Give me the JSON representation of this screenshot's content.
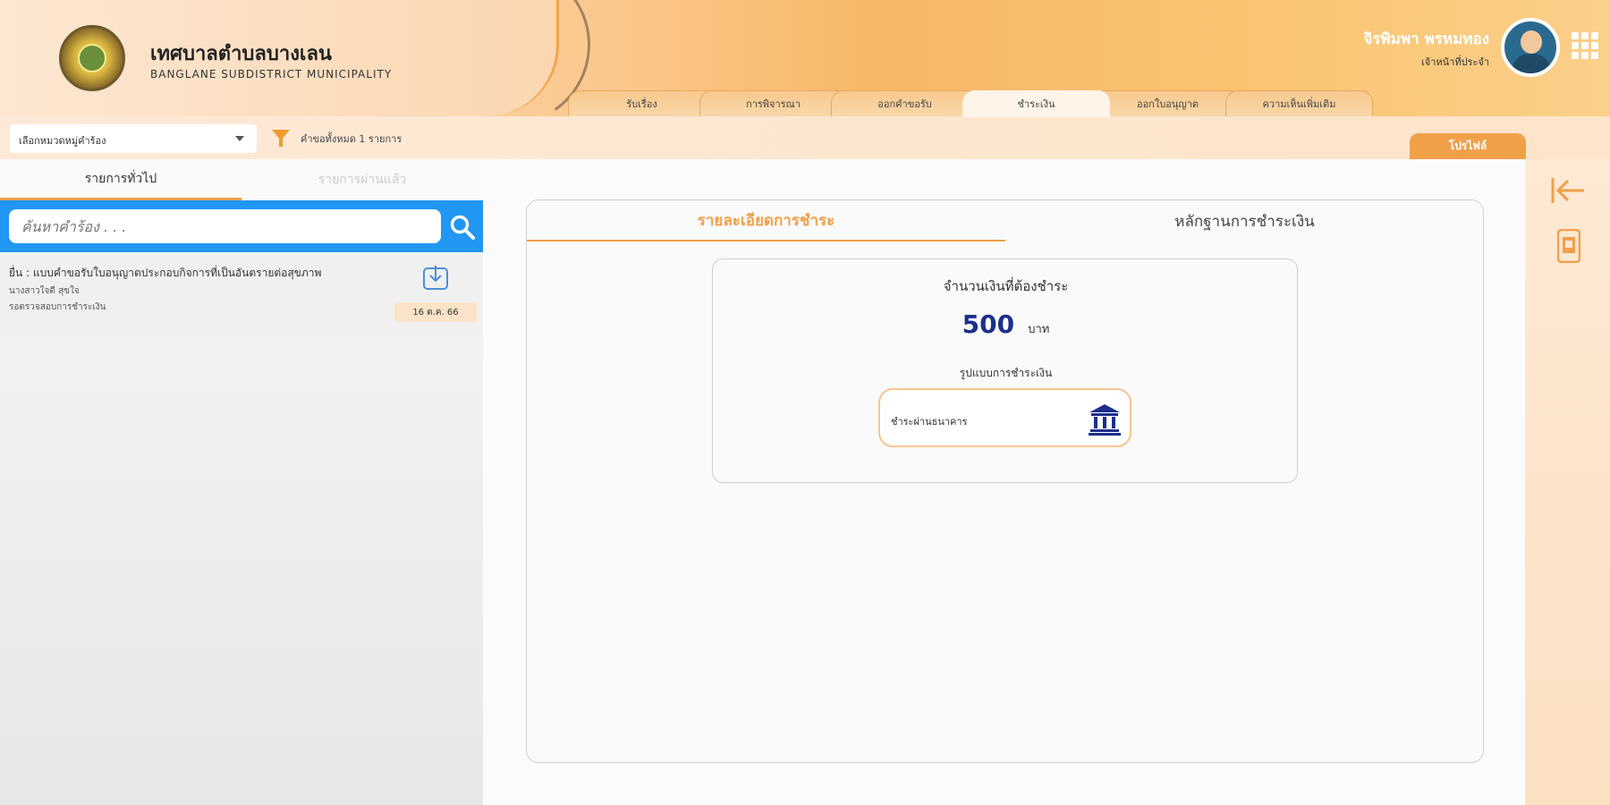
{
  "header": {
    "org_name": "เทศบาลตำบลบางเลน",
    "org_name_en": "BANGLANE SUBDISTRICT MUNICIPALITY",
    "user_name": "จิรพิมพา พรหมทอง",
    "user_role": "เจ้าหน้าที่ประจำ",
    "tabs": [
      {
        "label": "รับเรื่อง",
        "active": false
      },
      {
        "label": "การพิจารณา",
        "active": false
      },
      {
        "label": "ออกคำขอรับ",
        "active": false
      },
      {
        "label": "ชำระเงิน",
        "active": true
      },
      {
        "label": "ออกใบอนุญาต",
        "active": false
      },
      {
        "label": "ความเห็นเพิ่มเติม",
        "active": false
      }
    ]
  },
  "toolbar": {
    "filter_value": "เลือกหมวดหมู่คำร้อง",
    "filter_count": "คำขอทั้งหมด 1 รายการ",
    "profile_button": "โปรไฟล์"
  },
  "left": {
    "tabs": [
      "รายการทั่วไป",
      "รายการผ่านแล้ว"
    ],
    "search_placeholder": "ค้นหาคำร้อง . . .",
    "items": [
      {
        "title": "ยื่น : แบบคำขอรับใบอนุญาตประกอบกิจการที่เป็นอันตรายต่อสุขภาพ",
        "sub1": "นางสาวใจดี สุขใจ",
        "sub2": "รอตรวจสอบการชำระเงิน",
        "date": "16 ต.ค. 66"
      }
    ]
  },
  "card": {
    "tabs": [
      "รายละเอียดการชำระ",
      "หลักฐานการชำระเงิน"
    ],
    "amount_label": "จำนวนเงินที่ต้องชำระ",
    "amount_value": "500",
    "amount_unit": "บาท",
    "method_label": "รูปแบบการชำระเงิน",
    "method_option": "ชำระผ่านธนาคาร"
  },
  "colors": {
    "accent": "#f1a04a",
    "search_bar": "#2196f3",
    "amount": "#1c2f8a"
  },
  "icons": [
    "logo-emblem",
    "grid-icon",
    "chevron-down-icon",
    "funnel-icon",
    "search-icon",
    "download-icon",
    "bank-icon",
    "collapse-left-icon",
    "document-icon"
  ]
}
